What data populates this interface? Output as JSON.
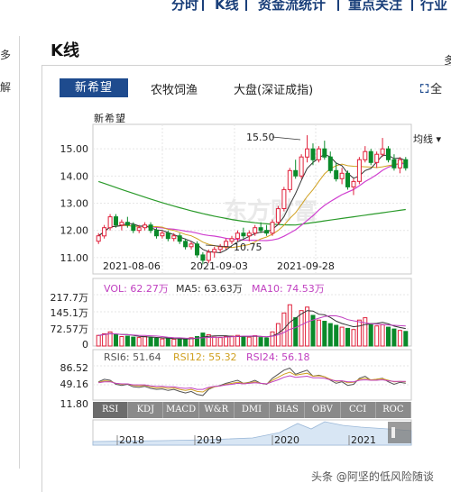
{
  "topnav": {
    "items": [
      "分时",
      "K线",
      "资金流统计",
      "重点关注",
      "行业"
    ]
  },
  "left_panel": {
    "label_top": "多",
    "label_mid": "解"
  },
  "title": "K线",
  "tabs": {
    "active": "新希望",
    "items": [
      "农牧饲渔",
      "大盘(深证成指)"
    ],
    "fullscreen_label": "全"
  },
  "stock_name": "新希望",
  "mode_label": "均线",
  "price_axis": {
    "ticks": [
      "15.00",
      "14.00",
      "13.00",
      "12.00",
      "11.00"
    ]
  },
  "annotations": {
    "high": "15.50",
    "low": "10.75"
  },
  "dates": [
    "2021-08-06",
    "2021-09-03",
    "2021-09-28"
  ],
  "volume": {
    "axis": [
      "217.7万",
      "145.1万",
      "72.57万",
      "0"
    ],
    "vol_label": "VOL: 62.27万",
    "ma5_label": "MA5: 63.63万",
    "ma10_label": "MA10: 74.53万"
  },
  "rsi": {
    "axis": [
      "86.52",
      "49.16",
      "11.80"
    ],
    "rsi6_label": "RSI6: 51.64",
    "rsi12_label": "RSI12: 55.32",
    "rsi24_label": "RSI24: 56.18"
  },
  "indicator_tabs": [
    "RSI",
    "KDJ",
    "MACD",
    "W&R",
    "DMI",
    "BIAS",
    "OBV",
    "CCI",
    "ROC"
  ],
  "timeline_years": [
    "2018",
    "2019",
    "2020",
    "2021"
  ],
  "credit": "头条 @阿坚的低风险随谈",
  "colors": {
    "up": "#e0203a",
    "down": "#0a8a2a",
    "accent": "#1e4b8e"
  },
  "chart_data": {
    "type": "candlestick",
    "ylim": [
      10.4,
      15.9
    ],
    "candles": [
      [
        11.6,
        11.9,
        11.5,
        11.8
      ],
      [
        11.8,
        12.2,
        11.7,
        12.1
      ],
      [
        12.1,
        12.6,
        12.0,
        12.5
      ],
      [
        12.5,
        12.6,
        12.1,
        12.2
      ],
      [
        12.2,
        12.4,
        12.0,
        12.3
      ],
      [
        12.3,
        12.5,
        12.1,
        12.2
      ],
      [
        12.2,
        12.3,
        11.9,
        12.0
      ],
      [
        12.0,
        12.2,
        11.9,
        12.1
      ],
      [
        12.1,
        12.3,
        12.0,
        12.2
      ],
      [
        12.2,
        12.3,
        11.9,
        12.0
      ],
      [
        12.0,
        12.1,
        11.7,
        11.8
      ],
      [
        11.8,
        12.0,
        11.7,
        11.9
      ],
      [
        11.9,
        12.0,
        11.6,
        11.7
      ],
      [
        11.7,
        11.9,
        11.6,
        11.8
      ],
      [
        11.8,
        11.9,
        11.5,
        11.6
      ],
      [
        11.6,
        11.7,
        11.3,
        11.4
      ],
      [
        11.4,
        11.6,
        11.3,
        11.5
      ],
      [
        11.5,
        11.6,
        11.0,
        11.1
      ],
      [
        11.1,
        11.2,
        10.75,
        10.9
      ],
      [
        10.9,
        11.3,
        10.8,
        11.2
      ],
      [
        11.2,
        11.4,
        11.0,
        11.3
      ],
      [
        11.3,
        11.5,
        11.2,
        11.4
      ],
      [
        11.4,
        11.7,
        11.3,
        11.6
      ],
      [
        11.6,
        11.8,
        11.5,
        11.7
      ],
      [
        11.7,
        12.0,
        11.6,
        11.9
      ],
      [
        11.9,
        12.1,
        11.7,
        11.8
      ],
      [
        11.8,
        12.0,
        11.6,
        11.9
      ],
      [
        11.9,
        12.2,
        11.8,
        12.1
      ],
      [
        12.1,
        12.3,
        11.9,
        12.0
      ],
      [
        12.0,
        12.2,
        11.8,
        11.9
      ],
      [
        11.9,
        12.4,
        11.8,
        12.3
      ],
      [
        12.3,
        12.9,
        12.2,
        12.8
      ],
      [
        12.8,
        13.6,
        12.7,
        13.5
      ],
      [
        13.5,
        14.3,
        13.4,
        14.2
      ],
      [
        14.2,
        14.6,
        13.9,
        14.0
      ],
      [
        14.0,
        14.8,
        13.9,
        14.7
      ],
      [
        14.7,
        15.5,
        14.5,
        15.0
      ],
      [
        15.0,
        15.2,
        14.4,
        14.6
      ],
      [
        14.6,
        15.1,
        14.5,
        15.0
      ],
      [
        15.0,
        15.3,
        14.6,
        14.7
      ],
      [
        14.7,
        14.9,
        14.1,
        14.2
      ],
      [
        14.2,
        14.5,
        13.8,
        13.9
      ],
      [
        13.9,
        14.3,
        13.7,
        14.1
      ],
      [
        14.1,
        14.2,
        13.5,
        13.6
      ],
      [
        13.6,
        13.9,
        13.3,
        13.8
      ],
      [
        13.8,
        14.7,
        13.7,
        14.6
      ],
      [
        14.6,
        15.1,
        14.5,
        14.9
      ],
      [
        14.9,
        15.0,
        14.4,
        14.5
      ],
      [
        14.5,
        14.9,
        14.3,
        14.8
      ],
      [
        14.8,
        15.4,
        14.7,
        15.0
      ],
      [
        15.0,
        15.1,
        14.5,
        14.6
      ],
      [
        14.6,
        14.8,
        14.2,
        14.3
      ],
      [
        14.3,
        14.7,
        14.1,
        14.6
      ],
      [
        14.6,
        14.7,
        14.2,
        14.3
      ]
    ],
    "volumes": [
      45,
      52,
      60,
      48,
      40,
      42,
      38,
      36,
      40,
      35,
      33,
      30,
      32,
      29,
      31,
      28,
      35,
      40,
      55,
      48,
      38,
      36,
      40,
      42,
      45,
      40,
      38,
      44,
      36,
      34,
      60,
      95,
      140,
      175,
      120,
      150,
      165,
      130,
      110,
      105,
      95,
      88,
      80,
      75,
      70,
      110,
      120,
      95,
      85,
      90,
      80,
      72,
      66,
      62
    ],
    "rsi6": [
      55,
      60,
      58,
      50,
      48,
      50,
      45,
      44,
      46,
      42,
      40,
      41,
      38,
      40,
      36,
      33,
      36,
      30,
      28,
      40,
      45,
      48,
      52,
      55,
      58,
      52,
      54,
      58,
      52,
      50,
      62,
      70,
      78,
      82,
      70,
      74,
      78,
      66,
      68,
      65,
      58,
      52,
      55,
      48,
      50,
      62,
      66,
      58,
      60,
      62,
      55,
      50,
      54,
      52
    ],
    "rsi12": [
      54,
      57,
      56,
      52,
      50,
      51,
      48,
      47,
      48,
      45,
      43,
      44,
      42,
      43,
      40,
      38,
      40,
      36,
      35,
      42,
      45,
      47,
      50,
      52,
      54,
      52,
      53,
      55,
      52,
      51,
      58,
      64,
      70,
      74,
      68,
      70,
      72,
      66,
      67,
      65,
      60,
      56,
      57,
      53,
      54,
      60,
      62,
      59,
      60,
      61,
      58,
      55,
      56,
      55
    ],
    "rsi24": [
      53,
      55,
      55,
      52,
      51,
      51,
      49,
      49,
      49,
      47,
      46,
      46,
      45,
      45,
      43,
      42,
      43,
      40,
      40,
      44,
      46,
      47,
      49,
      50,
      52,
      51,
      52,
      53,
      52,
      51,
      55,
      59,
      64,
      67,
      64,
      65,
      66,
      63,
      63,
      62,
      59,
      57,
      57,
      55,
      55,
      58,
      59,
      58,
      58,
      59,
      57,
      56,
      56,
      56
    ]
  }
}
